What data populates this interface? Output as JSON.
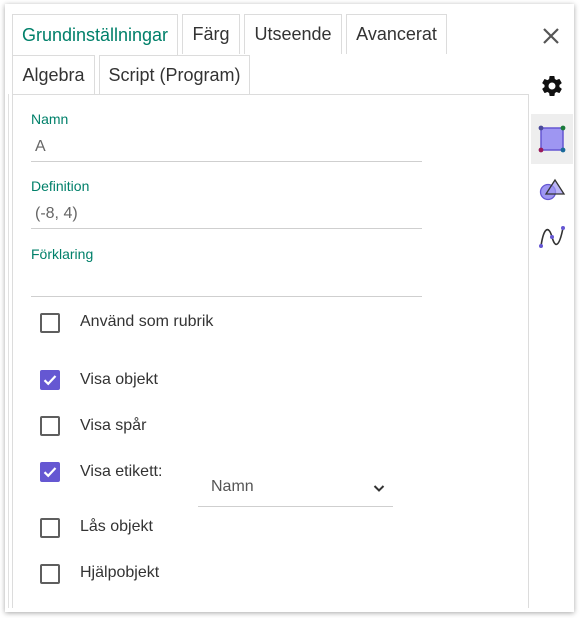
{
  "tabs_row1": [
    {
      "label": "Grundinställningar",
      "active": true
    },
    {
      "label": "Färg"
    },
    {
      "label": "Utseende"
    },
    {
      "label": "Avancerat"
    }
  ],
  "tabs_row2": [
    {
      "label": "Algebra"
    },
    {
      "label": "Script (Program)"
    }
  ],
  "fields": {
    "name": {
      "label": "Namn",
      "value": "A"
    },
    "definition": {
      "label": "Definition",
      "value": "(-8, 4)"
    },
    "caption": {
      "label": "Förklaring",
      "value": ""
    }
  },
  "checkboxes": [
    {
      "label": "Använd som rubrik",
      "checked": false
    },
    {
      "label": "Visa objekt",
      "checked": true
    },
    {
      "label": "Visa spår",
      "checked": false
    },
    {
      "label": "Visa etikett:",
      "checked": true
    },
    {
      "label": "Lås objekt",
      "checked": false
    },
    {
      "label": "Hjälpobjekt",
      "checked": false
    }
  ],
  "label_select": {
    "value": "Namn"
  },
  "sidebar": {
    "icons": [
      "gear-icon",
      "point-style-icon",
      "shapes-icon",
      "curve-icon"
    ],
    "selected": "point-style-icon"
  },
  "colors": {
    "accent": "#00806a",
    "checkbox": "#6557d2"
  }
}
